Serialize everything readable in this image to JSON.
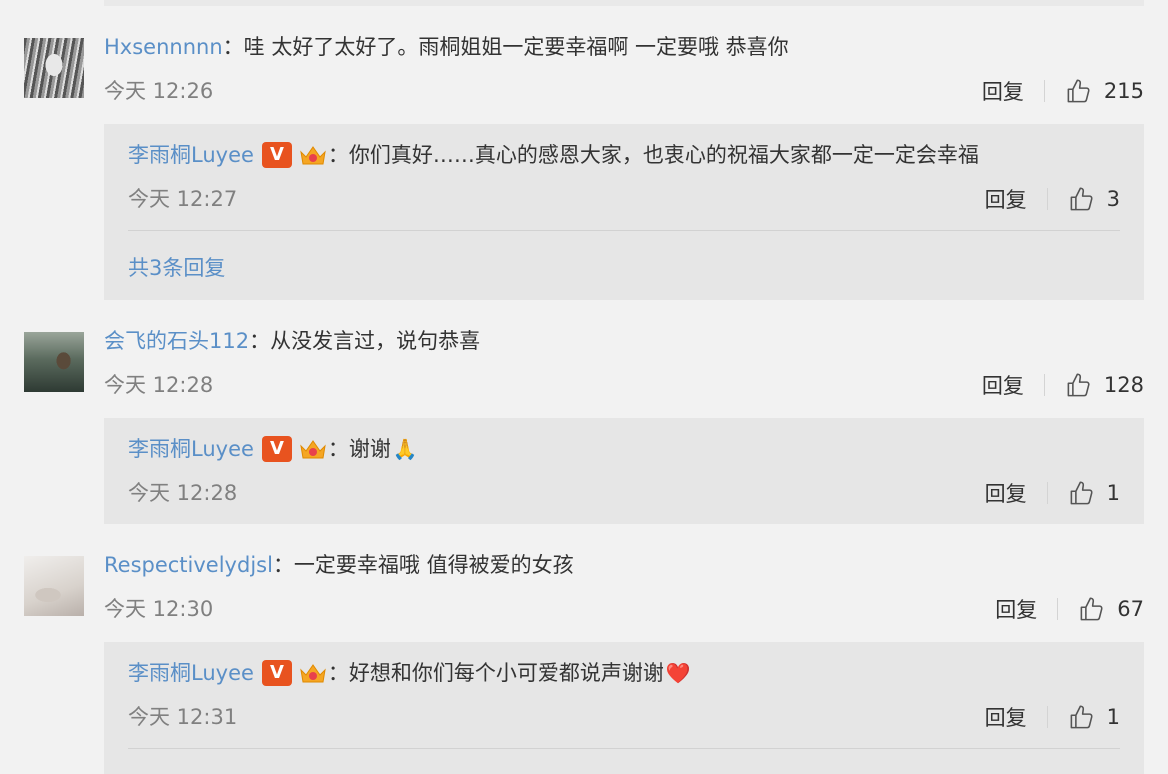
{
  "comments": [
    {
      "user": "Hxsennnnn",
      "text": "：哇 太好了太好了。雨桐姐姐一定要幸福啊 一定要哦 恭喜你",
      "time": "今天 12:26",
      "reply_label": "回复",
      "likes": "215",
      "reply": {
        "user": "李雨桐Luyee",
        "text": "：你们真好……真心的感恩大家，也衷心的祝福大家都一定一定会幸福",
        "time": "今天 12:27",
        "reply_label": "回复",
        "likes": "3"
      },
      "more_replies": "共3条回复"
    },
    {
      "user": "会飞的石头112",
      "text": "：从没发言过，说句恭喜",
      "time": "今天 12:28",
      "reply_label": "回复",
      "likes": "128",
      "reply": {
        "user": "李雨桐Luyee",
        "text": "：谢谢",
        "emoji": "🙏",
        "time": "今天 12:28",
        "reply_label": "回复",
        "likes": "1"
      }
    },
    {
      "user": "Respectivelydjsl",
      "text": "：一定要幸福哦 值得被爱的女孩",
      "time": "今天 12:30",
      "reply_label": "回复",
      "likes": "67",
      "reply": {
        "user": "李雨桐Luyee",
        "text": "：好想和你们每个小可爱都说声谢谢",
        "emoji": "❤️",
        "time": "今天 12:31",
        "reply_label": "回复",
        "likes": "1"
      }
    }
  ],
  "badges": {
    "v_label": "V"
  },
  "colors": {
    "username": "#5a8fc7",
    "meta": "#808080",
    "v_badge": "#e8531f",
    "reply_bg": "#e6e6e6"
  }
}
